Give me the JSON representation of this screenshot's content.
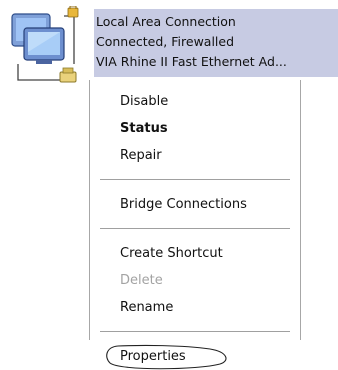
{
  "connection": {
    "icon": "network-connection-icon",
    "name": "Local Area Connection",
    "status": "Connected, Firewalled",
    "device": "VIA Rhine II Fast Ethernet Ad..."
  },
  "context_menu": {
    "items": {
      "disable": "Disable",
      "status": "Status",
      "repair": "Repair",
      "bridge": "Bridge Connections",
      "create_shortcut": "Create Shortcut",
      "delete": "Delete",
      "rename": "Rename",
      "properties": "Properties"
    },
    "default_item": "Status",
    "disabled_items": [
      "Delete"
    ],
    "highlighted_item": "Properties"
  },
  "colors": {
    "selection_background": "#c7cbe3",
    "separator": "#a0a0a0",
    "disabled_text": "#a3a3a3"
  }
}
